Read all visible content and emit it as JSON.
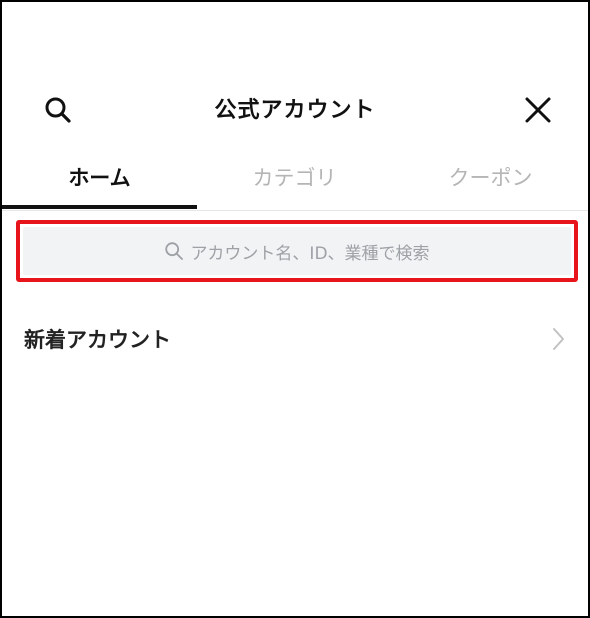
{
  "header": {
    "title": "公式アカウント",
    "search_icon": "search-icon",
    "close_icon": "close-icon"
  },
  "tabs": [
    {
      "label": "ホーム",
      "active": true
    },
    {
      "label": "カテゴリ",
      "active": false
    },
    {
      "label": "クーポン",
      "active": false
    }
  ],
  "search": {
    "placeholder": "アカウント名、ID、業種で検索",
    "highlight_color": "#e8141b"
  },
  "sections": [
    {
      "label": "新着アカウント",
      "icon": "chevron-right-icon"
    }
  ]
}
